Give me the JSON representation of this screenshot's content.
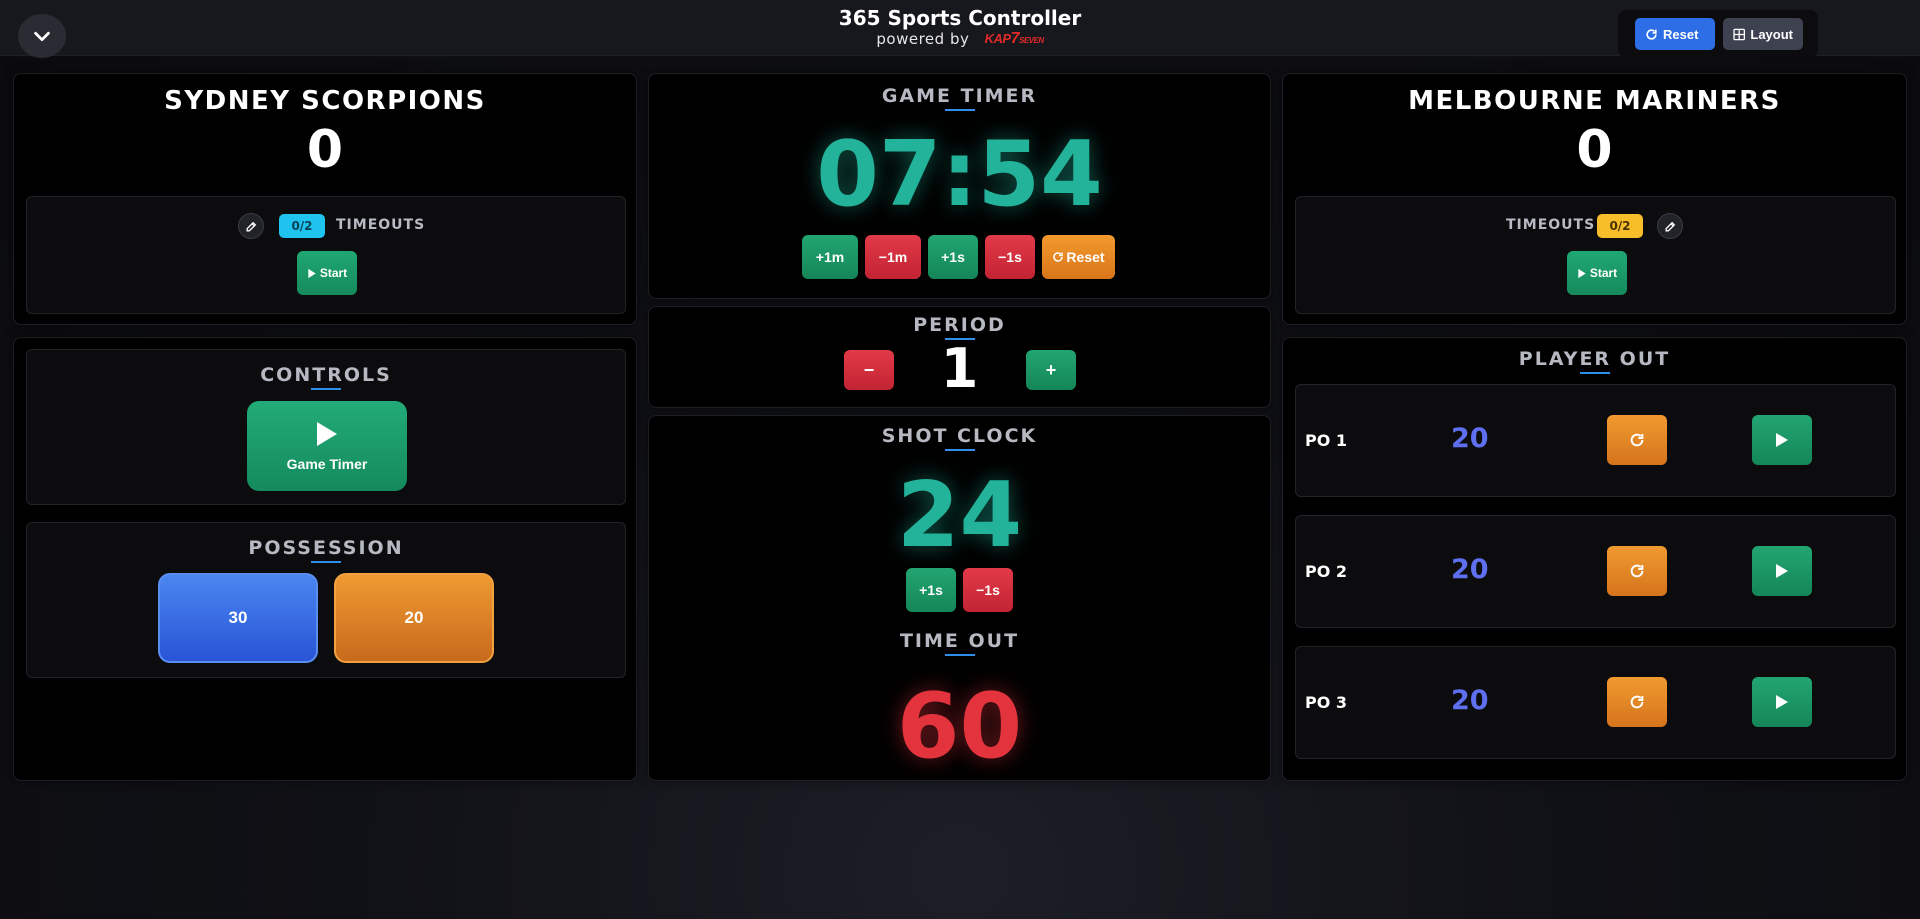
{
  "header": {
    "title": "365 Sports Controller",
    "powered_by": "powered by",
    "brand_logo": "KAP SEVEN",
    "reset_label": "Reset",
    "layout_label": "Layout"
  },
  "home": {
    "name": "SYDNEY SCORPIONS",
    "score": "0",
    "timeouts_badge": "0/2",
    "timeouts_label": "TIMEOUTS",
    "start_label": "Start",
    "badge_color": "#1ec3ee"
  },
  "away": {
    "name": "MELBOURNE MARINERS",
    "score": "0",
    "timeouts_badge": "0/2",
    "timeouts_label": "TIMEOUTS",
    "start_label": "Start",
    "badge_color": "#f7be2a"
  },
  "game_timer": {
    "title": "GAME TIMER",
    "value": "07:54",
    "buttons": [
      "+1m",
      "−1m",
      "+1s",
      "−1s",
      "Reset"
    ]
  },
  "period": {
    "title": "PERIOD",
    "value": "1",
    "minus": "−",
    "plus": "+"
  },
  "shot_clock": {
    "title": "SHOT CLOCK",
    "value": "24",
    "buttons": [
      "+1s",
      "−1s"
    ]
  },
  "time_out": {
    "title": "TIME OUT",
    "value": "60"
  },
  "controls": {
    "title": "CONTROLS",
    "game_timer_label": "Game Timer"
  },
  "possession": {
    "title": "POSSESSION",
    "left_value": "30",
    "right_value": "20"
  },
  "player_out": {
    "title": "PLAYER OUT",
    "rows": [
      {
        "label": "PO 1",
        "value": "20"
      },
      {
        "label": "PO 2",
        "value": "20"
      },
      {
        "label": "PO 3",
        "value": "20"
      }
    ]
  },
  "colors": {
    "accent_green": "#22b39a",
    "timeout_red": "#e3343e",
    "primary_blue": "#2d6de6",
    "po_value": "#5e6ff0"
  }
}
